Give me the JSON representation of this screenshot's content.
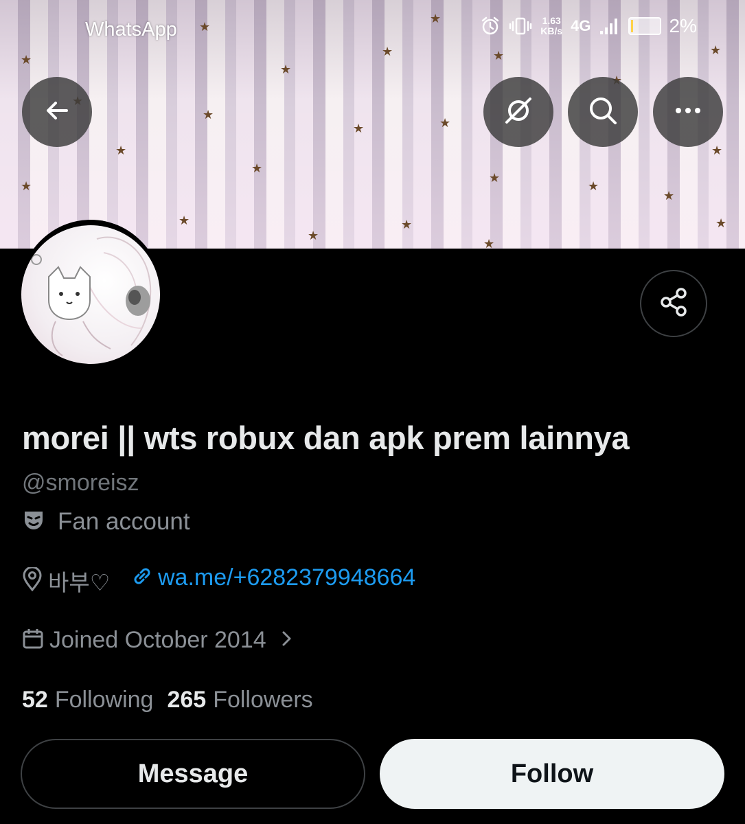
{
  "status_bar": {
    "app_name": "WhatsApp",
    "net_speed_value": "1.63",
    "net_speed_unit": "KB/s",
    "network_type": "4G",
    "battery_percent": "2%",
    "battery_level": 0.02
  },
  "header": {
    "back_icon": "arrow-left-icon",
    "translate_icon": "no-translate-icon",
    "search_icon": "search-icon",
    "more_icon": "more-icon"
  },
  "profile": {
    "display_name": "morei || wts robux dan apk prem lainnya",
    "handle": "@smoreisz",
    "category": "Fan account",
    "location": "바부♡",
    "link": "wa.me/+6282379948664",
    "joined": "Joined October 2014",
    "following_count": "52",
    "following_label": "Following",
    "followers_count": "265",
    "followers_label": "Followers"
  },
  "actions": {
    "message_label": "Message",
    "follow_label": "Follow"
  },
  "colors": {
    "background": "#000000",
    "text_primary": "#e7e9ea",
    "text_secondary": "#8b9096",
    "link": "#1d9bf0",
    "follow_bg": "#eff3f4"
  }
}
